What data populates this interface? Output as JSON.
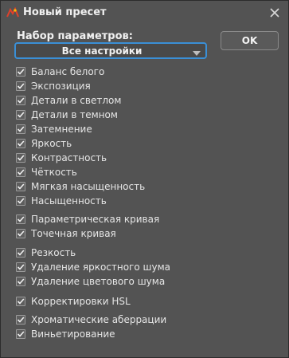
{
  "window": {
    "title": "Новый пресет",
    "close_icon": "close-icon",
    "app_icon": "photoshop-camera-raw-icon"
  },
  "preset": {
    "group_label": "Набор параметров:",
    "selected": "Все настройки"
  },
  "ok_label": "OK",
  "items": [
    {
      "label": "Баланс белого",
      "checked": true
    },
    {
      "label": "Экспозиция",
      "checked": true
    },
    {
      "label": "Детали в светлом",
      "checked": true
    },
    {
      "label": "Детали в темном",
      "checked": true
    },
    {
      "label": "Затемнение",
      "checked": true
    },
    {
      "label": "Яркость",
      "checked": true
    },
    {
      "label": "Контрастность",
      "checked": true
    },
    {
      "label": "Чёткость",
      "checked": true
    },
    {
      "label": "Мягкая насыщенность",
      "checked": true
    },
    {
      "label": "Насыщенность",
      "checked": true
    },
    {
      "label": "Параметрическая кривая",
      "checked": true
    },
    {
      "label": "Точечная кривая",
      "checked": true
    },
    {
      "label": "Резкость",
      "checked": true
    },
    {
      "label": "Удаление яркостного шума",
      "checked": true
    },
    {
      "label": "Удаление цветового шума",
      "checked": true
    },
    {
      "label": "Корректировки HSL",
      "checked": true
    },
    {
      "label": "Хроматические аберрации",
      "checked": true
    },
    {
      "label": "Виньетирование",
      "checked": true
    }
  ],
  "colors": {
    "background": "#535353",
    "accent": "#3a8fd6",
    "text": "#e6e6e6"
  }
}
